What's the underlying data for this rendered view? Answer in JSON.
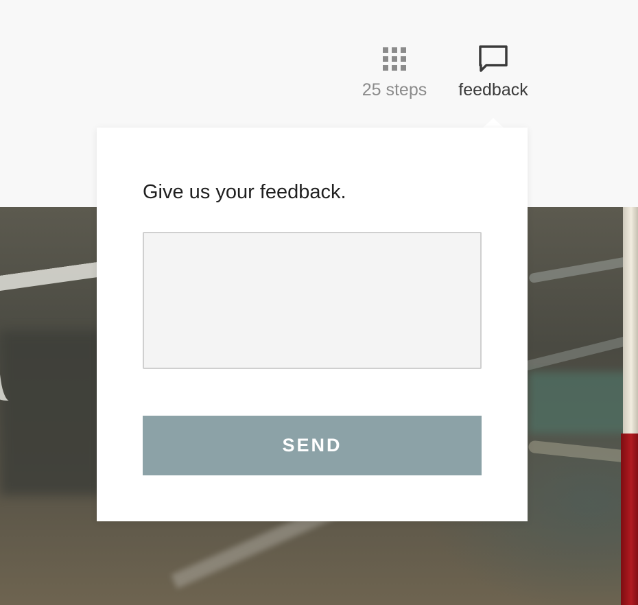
{
  "header": {
    "steps_label": "25 steps",
    "steps_icon": "grid-icon",
    "feedback_label": "feedback",
    "feedback_icon": "speech-bubble-icon"
  },
  "feedback_popover": {
    "title": "Give us your feedback.",
    "textarea_value": "",
    "textarea_placeholder": "",
    "send_label": "SEND"
  },
  "colors": {
    "send_button": "#8ca2a7",
    "textarea_bg": "#f4f4f4",
    "topbar_bg": "#f8f8f8"
  }
}
